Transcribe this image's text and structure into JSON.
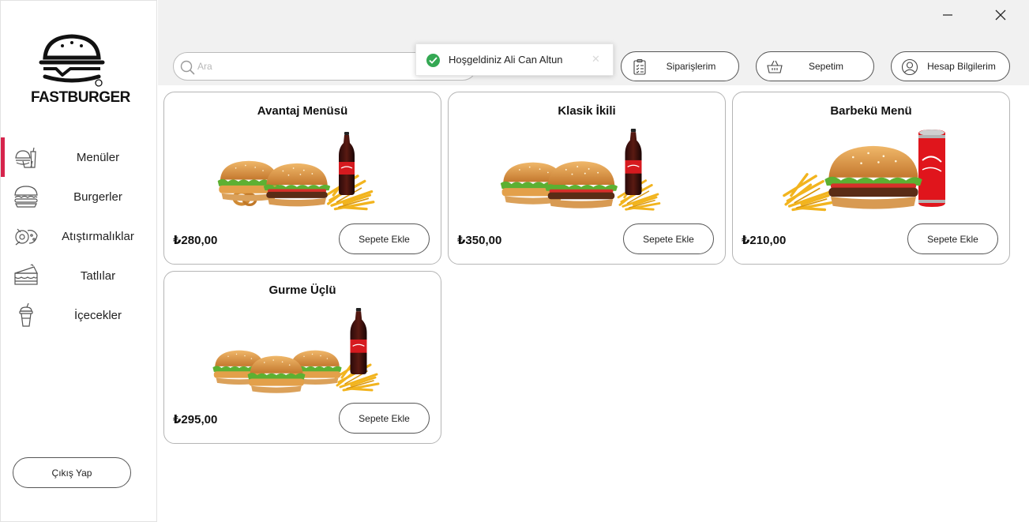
{
  "brand": {
    "name": "FASTBURGER"
  },
  "window": {
    "minimize_icon": "minimize-icon",
    "close_icon": "close-icon"
  },
  "sidebar": {
    "items": [
      {
        "label": "Menüler",
        "icon": "menu-combo-icon",
        "active": true
      },
      {
        "label": "Burgerler",
        "icon": "burger-icon",
        "active": false
      },
      {
        "label": "Atıştırmalıklar",
        "icon": "snacks-icon",
        "active": false
      },
      {
        "label": "Tatlılar",
        "icon": "cake-icon",
        "active": false
      },
      {
        "label": "İçecekler",
        "icon": "drink-cup-icon",
        "active": false
      }
    ],
    "logout_label": "Çıkış Yap"
  },
  "search": {
    "placeholder": "Ara",
    "value": ""
  },
  "toast": {
    "message": "Hoşgeldiniz Ali Can Altun",
    "icon": "check-circle-icon",
    "close_icon": "close-icon"
  },
  "header": {
    "orders_label": "Siparişlerim",
    "cart_label": "Sepetim",
    "account_label": "Hesap Bilgilerim"
  },
  "products": [
    {
      "title": "Avantaj Menüsü",
      "price": "₺280,00",
      "button": "Sepete Ekle"
    },
    {
      "title": "Klasik İkili",
      "price": "₺350,00",
      "button": "Sepete Ekle"
    },
    {
      "title": "Barbekü Menü",
      "price": "₺210,00",
      "button": "Sepete Ekle"
    },
    {
      "title": "Gurme Üçlü",
      "price": "₺295,00",
      "button": "Sepete Ekle"
    }
  ],
  "colors": {
    "accent": "#d6244c",
    "toast_success": "#34a853",
    "topbar_bg": "#f1f1f1"
  }
}
